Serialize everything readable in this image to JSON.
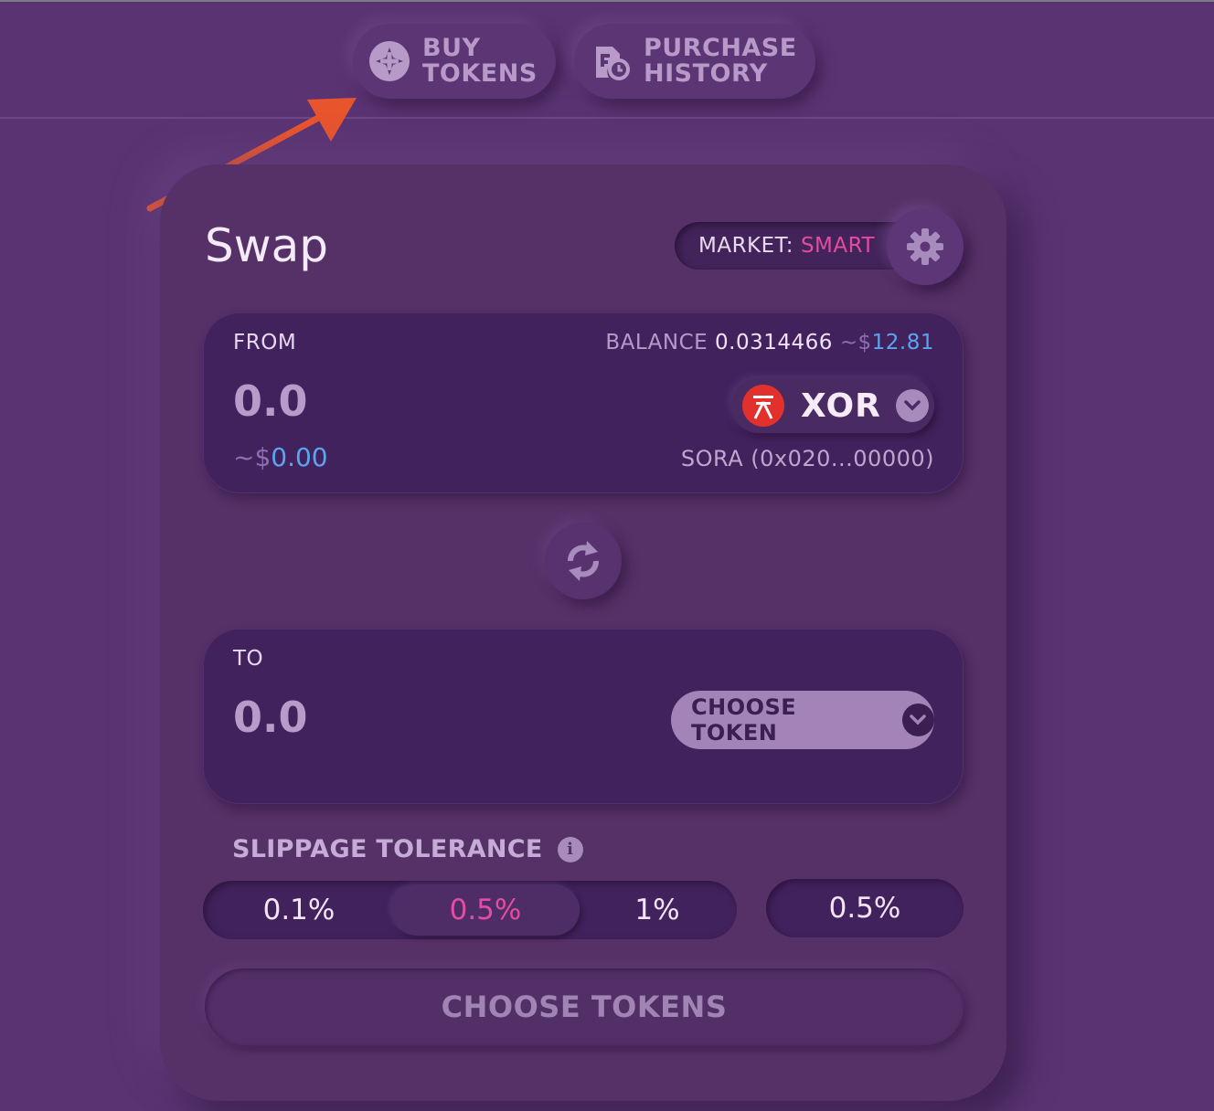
{
  "nav": {
    "buy": {
      "line1": "BUY",
      "line2": "TOKENS",
      "icon": "plus-circle-icon"
    },
    "history": {
      "line1": "PURCHASE",
      "line2": "HISTORY",
      "icon": "history-icon"
    }
  },
  "swap": {
    "title": "Swap",
    "market_label": "MARKET:",
    "market_value": "SMART"
  },
  "from": {
    "label": "FROM",
    "balance_label": "BALANCE",
    "balance_value": "0.0314466",
    "balance_usd_prefix": "~$",
    "balance_usd": "12.81",
    "amount": "0.0",
    "fiat_prefix": "~$",
    "fiat_value": "0.00",
    "token": "XOR",
    "token_address": "SORA (0x020...00000)"
  },
  "to": {
    "label": "TO",
    "amount": "0.0",
    "choose_label": "CHOOSE TOKEN"
  },
  "slippage": {
    "title": "SLIPPAGE TOLERANCE",
    "options": [
      "0.1%",
      "0.5%",
      "1%"
    ],
    "selected": "0.5%",
    "custom": "0.5%"
  },
  "submit": {
    "label": "CHOOSE TOKENS"
  },
  "colors": {
    "accent": "#e24ca1",
    "fiat": "#5aa4f0",
    "background": "#5a3472",
    "arrow": "#e8542c"
  }
}
